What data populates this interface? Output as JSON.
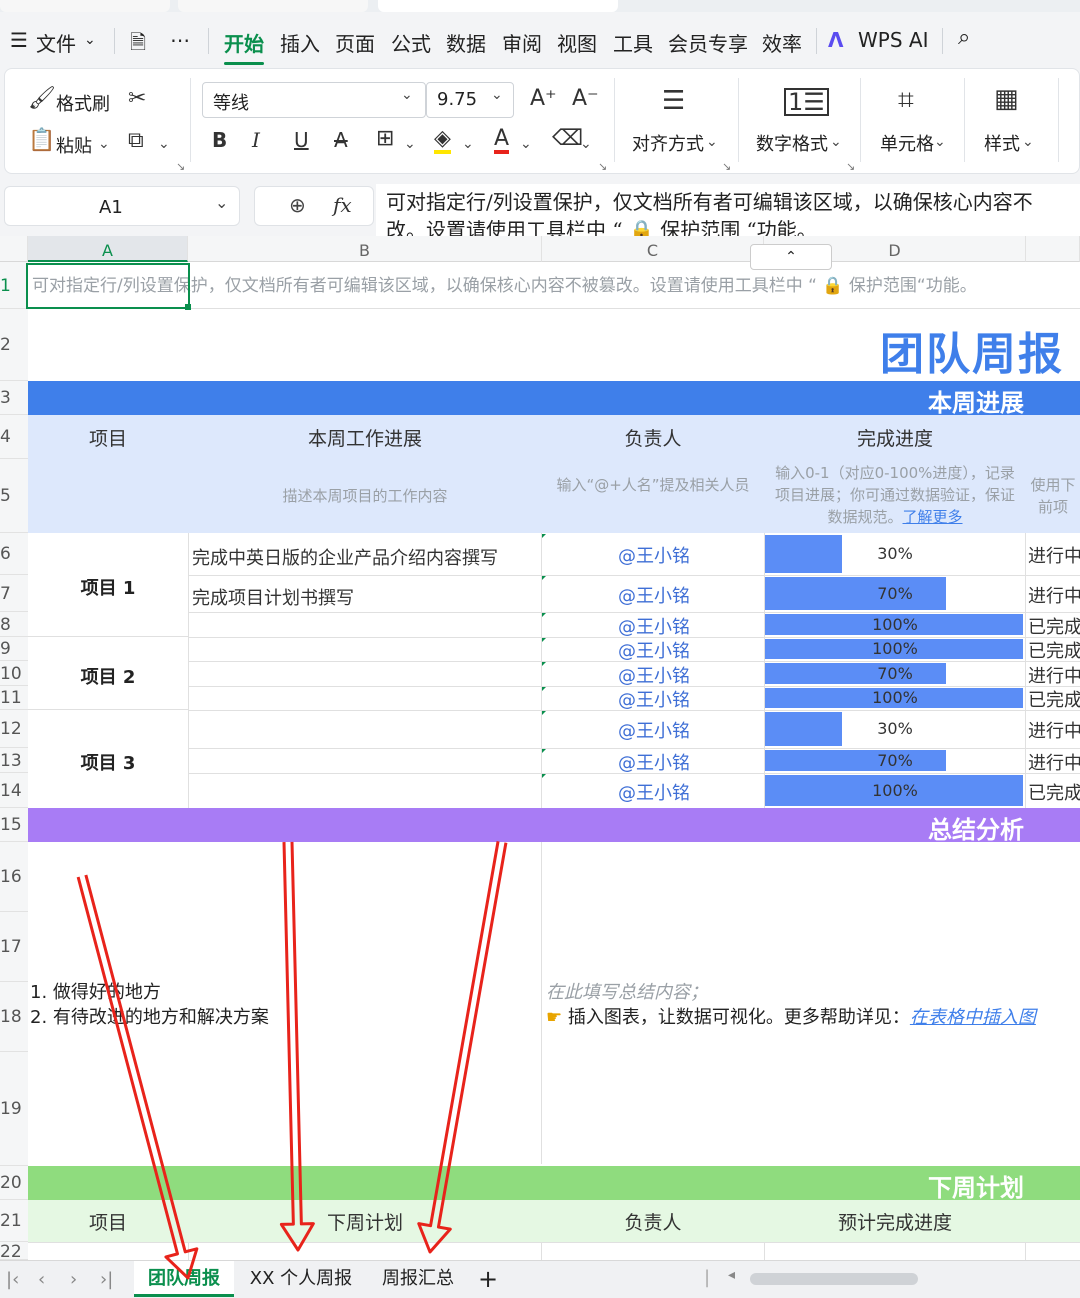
{
  "menu": {
    "file": "文件",
    "items": [
      "开始",
      "插入",
      "页面",
      "公式",
      "数据",
      "审阅",
      "视图",
      "工具",
      "会员专享",
      "效率"
    ],
    "ai": "WPS AI"
  },
  "ribbon": {
    "format_painter": "格式刷",
    "paste": "粘贴",
    "font_name": "等线",
    "font_size": "9.75",
    "align": "对齐方式",
    "number_format": "数字格式",
    "cell": "单元格",
    "style": "样式"
  },
  "formula_bar": {
    "name_box": "A1",
    "content_line1": "可对指定行/列设置保护，仅文档所有者可编辑该区域，以确保核心内容不",
    "content_line2": "改。设置请使用工具栏中 “ 🔒 保护范围 “功能。"
  },
  "columns": [
    "A",
    "B",
    "C",
    "D"
  ],
  "rows": [
    "1",
    "2",
    "3",
    "4",
    "5",
    "6",
    "7",
    "8",
    "9",
    "10",
    "11",
    "12",
    "13",
    "14",
    "15",
    "16",
    "17",
    "18",
    "19",
    "20",
    "21",
    "22"
  ],
  "sheet": {
    "hint": "可对指定行/列设置保护，仅文档所有者可编辑该区域，以确保核心内容不被篡改。设置请使用工具栏中 “ 🔒 保护范围“功能。",
    "title": "团队周报",
    "band_progress": "本周进展",
    "headers": {
      "project": "项目",
      "progress": "本周工作进展",
      "owner": "负责人",
      "completion": "完成进度"
    },
    "hints": {
      "progress": "描述本周项目的工作内容",
      "owner": "输入“@+人名”提及相关人员",
      "completion_text": "输入0-1（对应0-100%进度），记录项目进展；你可通过数据验证，保证数据规范。",
      "completion_link": "了解更多",
      "status": "使用下前项"
    },
    "projects": [
      "项目 1",
      "项目 2",
      "项目 3"
    ],
    "tasks": [
      "完成中英日版的企业产品介绍内容撰写",
      "完成项目计划书撰写"
    ],
    "owner_name": "@王小铭",
    "band_summary": "总结分析",
    "summary_left_1": "1. 做得好的地方",
    "summary_left_2": "2. 有待改进的地方和解决方案",
    "summary_placeholder": "在此填写总结内容；",
    "summary_tip": "插入图表，让数据可视化。更多帮助详见：",
    "summary_link": "在表格中插入图",
    "band_next": "下周计划",
    "next_headers": {
      "project": "项目",
      "plan": "下周计划",
      "owner": "负责人",
      "expected": "预计完成进度"
    }
  },
  "progress_rows": [
    {
      "row": "6",
      "pct": "30%",
      "value": 0.3,
      "status": "进行中"
    },
    {
      "row": "7",
      "pct": "70%",
      "value": 0.7,
      "status": "进行中"
    },
    {
      "row": "8",
      "pct": "100%",
      "value": 1.0,
      "status": "已完成"
    },
    {
      "row": "9",
      "pct": "100%",
      "value": 1.0,
      "status": "已完成"
    },
    {
      "row": "10",
      "pct": "70%",
      "value": 0.7,
      "status": "进行中"
    },
    {
      "row": "11",
      "pct": "100%",
      "value": 1.0,
      "status": "已完成"
    },
    {
      "row": "12",
      "pct": "30%",
      "value": 0.3,
      "status": "进行中"
    },
    {
      "row": "13",
      "pct": "70%",
      "value": 0.7,
      "status": "进行中"
    },
    {
      "row": "14",
      "pct": "100%",
      "value": 1.0,
      "status": "已完成"
    }
  ],
  "sheet_tabs": [
    "团队周报",
    "XX 个人周报",
    "周报汇总"
  ],
  "colors": {
    "accent": "#0a8f4d",
    "blue_band": "#3f7fea",
    "purple_band": "#a87cf5",
    "green_band": "#8fdc7e",
    "progress_bar": "#5b8df6",
    "annotation_arrow": "#e8231b"
  }
}
